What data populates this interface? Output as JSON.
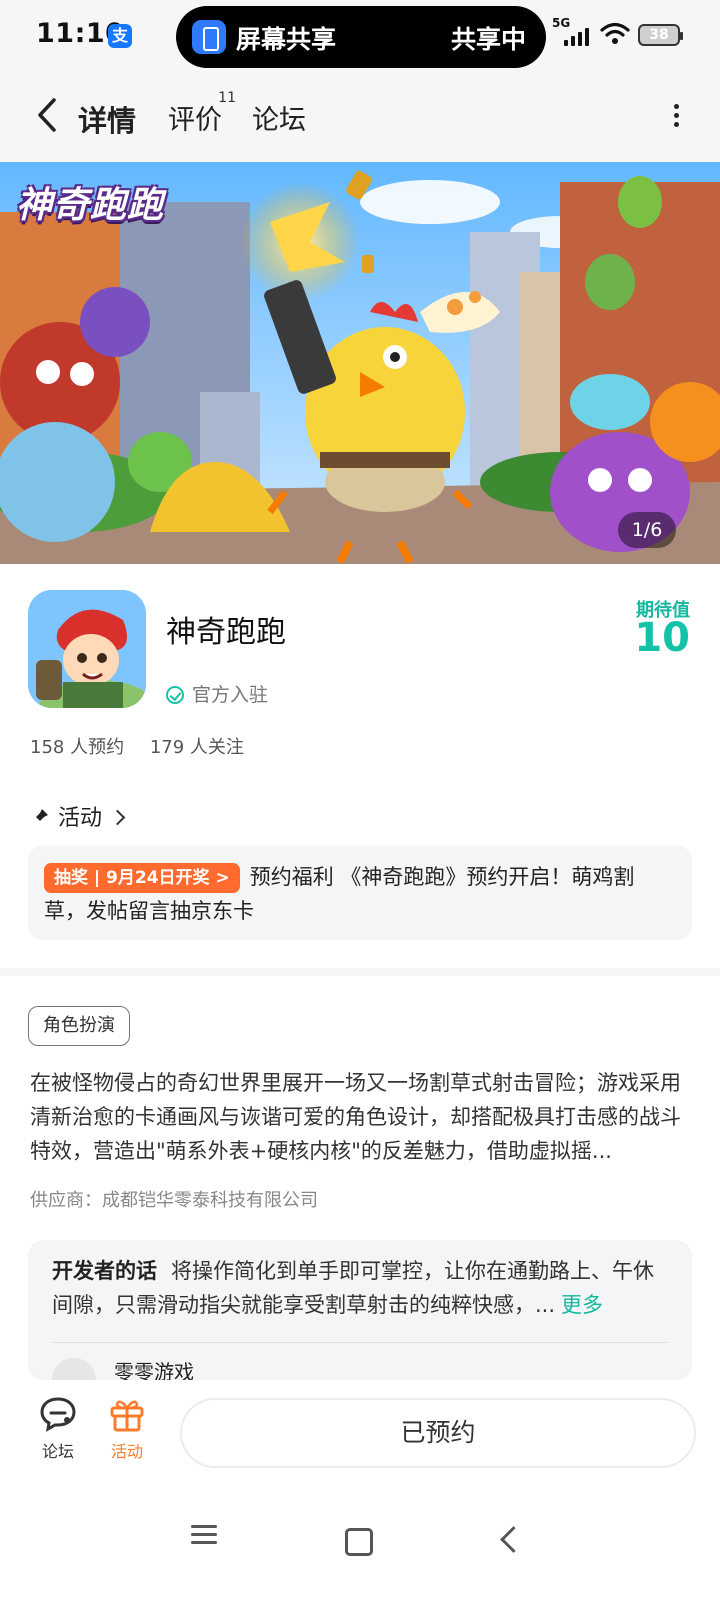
{
  "status_bar": {
    "time": "11:10",
    "alipay_badge": "支",
    "share_title": "屏幕共享",
    "share_status": "共享中",
    "network": "5G",
    "battery": "38"
  },
  "nav": {
    "tabs": [
      {
        "label": "详情",
        "active": true
      },
      {
        "label": "评价",
        "badge": "11"
      },
      {
        "label": "论坛"
      }
    ]
  },
  "banner": {
    "logo_text": "神奇跑跑",
    "counter": "1/6"
  },
  "game": {
    "name": "神奇跑跑",
    "official_label": "官方入驻",
    "expect_label": "期待值",
    "expect_value": "10",
    "reservations": "158 人预约",
    "followers": "179 人关注"
  },
  "activity": {
    "header": "活动",
    "tag": "抽奖 | 9月24日开奖 >",
    "text": "预约福利 《神奇跑跑》预约开启！萌鸡割草，发帖留言抽京东卡"
  },
  "details": {
    "genre": "角色扮演",
    "description": "在被怪物侵占的奇幻世界里展开一场又一场割草式射击冒险；游戏采用清新治愈的卡通画风与诙谐可爱的角色设计，却搭配极具打击感的战斗特效，营造出\"萌系外表+硬核内核\"的反差魅力，借助虚拟摇...",
    "supplier": "供应商：成都铠华零泰科技有限公司"
  },
  "developer": {
    "label": "开发者的话",
    "text": "将操作简化到单手即可掌控，让你在通勤路上、午休间隙，只需滑动指尖就能享受割草射击的纯粹快感，...",
    "more": "更多",
    "author": "零零游戏"
  },
  "bottom_bar": {
    "forum_label": "论坛",
    "activity_label": "活动",
    "reserve_label": "已预约"
  },
  "colors": {
    "accent": "#13c3a8",
    "activity_orange": "#ff6a2e"
  }
}
